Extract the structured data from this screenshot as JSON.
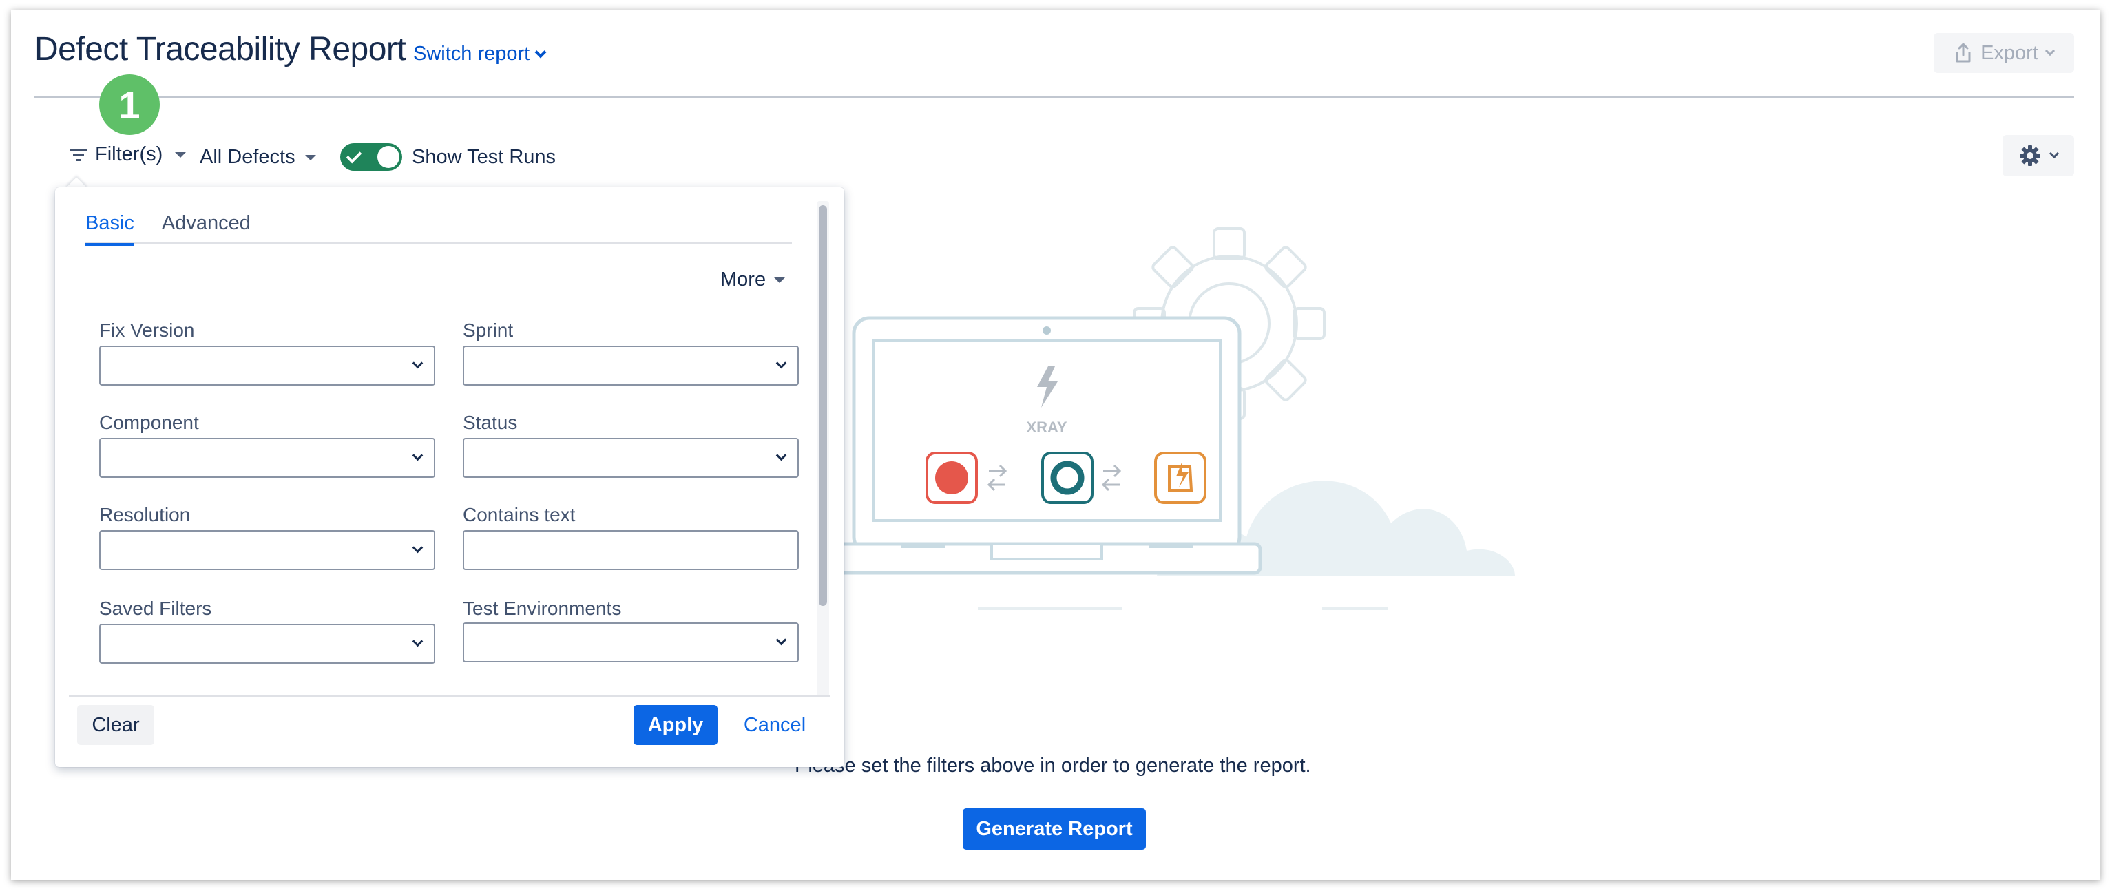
{
  "header": {
    "title": "Defect Traceability Report",
    "switch_report": "Switch report",
    "export": "Export"
  },
  "badge": {
    "number": "1",
    "color": "#5fc068"
  },
  "toolbar": {
    "filters_label": "Filter(s)",
    "defect_scope": "All Defects",
    "show_test_runs_label": "Show Test Runs",
    "show_test_runs_on": true
  },
  "filter_popup": {
    "tabs": [
      {
        "label": "Basic",
        "active": true
      },
      {
        "label": "Advanced",
        "active": false
      }
    ],
    "more_label": "More",
    "fields": [
      {
        "label": "Fix Version",
        "type": "select",
        "value": ""
      },
      {
        "label": "Sprint",
        "type": "select",
        "value": ""
      },
      {
        "label": "Component",
        "type": "select",
        "value": ""
      },
      {
        "label": "Status",
        "type": "select",
        "value": ""
      },
      {
        "label": "Resolution",
        "type": "select",
        "value": ""
      },
      {
        "label": "Contains text",
        "type": "text",
        "value": ""
      },
      {
        "label": "Saved Filters",
        "type": "select",
        "value": ""
      },
      {
        "label": "Test Environments",
        "type": "select",
        "value": ""
      }
    ],
    "clear_label": "Clear",
    "apply_label": "Apply",
    "cancel_label": "Cancel"
  },
  "illustration": {
    "brand": "XRAY"
  },
  "empty_state": {
    "message": "Please set the filters above in order to generate the report.",
    "generate_label": "Generate Report"
  },
  "colors": {
    "primary": "#0c66e4",
    "toggle_on": "#1f845a",
    "text": "#172b4d"
  }
}
